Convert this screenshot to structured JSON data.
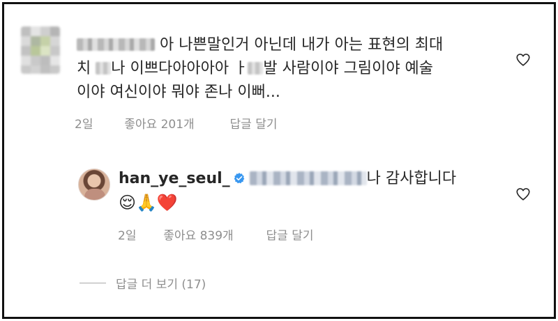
{
  "comment": {
    "line1_text": "아 나쁜말인거 아닌데 내가 아는 표현의 최대",
    "line2_prefix": "치 ",
    "line2_mid": "나 이쁘다아아아아 ",
    "line2_fragment": "ㅏ",
    "line2_suffix": "발 사람이야 그림이야 예술",
    "line3_text": "이야 여신이야 뭐야 존나 이뻐...",
    "time": "2일",
    "likes": "좋아요 201개",
    "reply_action": "답글 달기"
  },
  "reply": {
    "username": "han_ye_seul_",
    "text_after_mention": "나 감사합니다",
    "emojis": "😌🙏❤️",
    "time": "2일",
    "likes": "좋아요 839개",
    "reply_action": "답글 달기"
  },
  "view_more": {
    "label": "답글 더 보기 (17)"
  },
  "colors": {
    "text": "#262626",
    "secondary": "#8e8e8e",
    "verified": "#3897f0",
    "heart_outline": "#262626",
    "border": "#111111"
  },
  "icons": {
    "like": "heart-outline-icon",
    "verified": "verified-badge-icon"
  }
}
